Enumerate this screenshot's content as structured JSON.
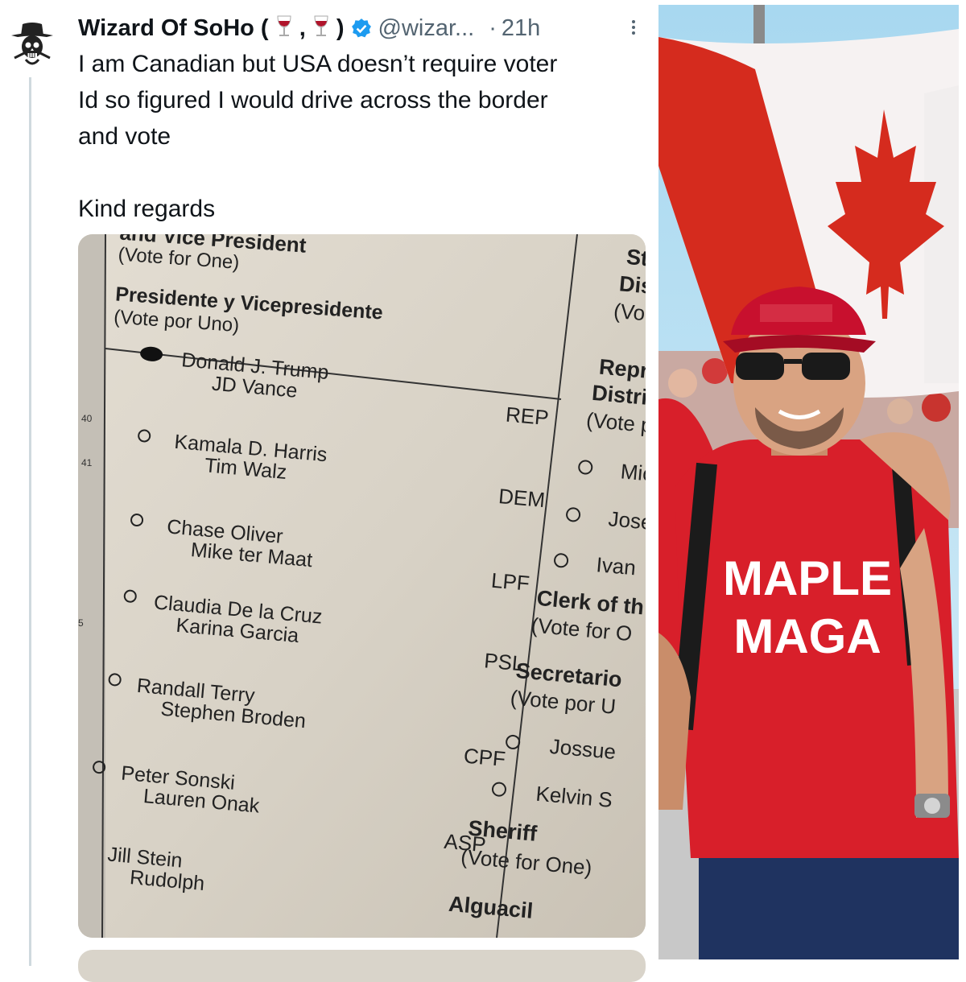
{
  "tweet": {
    "display_name": "Wizard Of SoHo (",
    "name_sep": ",",
    "name_close": ")",
    "handle": "@wizar...",
    "dot": "·",
    "time": "21h",
    "avatar_icon": "skull-cowboy-avatar-icon",
    "verified_color": "#1d9bf0",
    "text_lines": [
      "I am Canadian but USA doesn’t require voter",
      "Id so figured I would drive across the border",
      "and vote",
      "Kind regards"
    ]
  },
  "ballot": {
    "header_top": "and Vice President",
    "vote_for_one": "(Vote for One)",
    "header_es": "Presidente y Vicepresidente",
    "vote_por_uno": "(Vote por Uno)",
    "row_numbers": [
      "40",
      "41",
      "5"
    ],
    "candidates": [
      {
        "p": "Donald J. Trump",
        "vp": "JD Vance",
        "party": "REP",
        "filled": true
      },
      {
        "p": "Kamala D. Harris",
        "vp": "Tim Walz",
        "party": "DEM",
        "filled": false
      },
      {
        "p": "Chase Oliver",
        "vp": "Mike ter Maat",
        "party": "LPF",
        "filled": false
      },
      {
        "p": "Claudia De la Cruz",
        "vp": "Karina Garcia",
        "party": "PSL",
        "filled": false
      },
      {
        "p": "Randall Terry",
        "vp": "Stephen Broden",
        "party": "CPF",
        "filled": false
      },
      {
        "p": "Peter Sonski",
        "vp": "Lauren Onak",
        "party": "ASP",
        "filled": false
      },
      {
        "p": "Jill Stein",
        "vp": "Rudolph",
        "party": "",
        "filled": false
      }
    ],
    "right_column": {
      "state": "State",
      "distri": "Distri",
      "vote_t": "(Vote f",
      "repres": "Repres",
      "distrito": "Distrito",
      "vote_po": "(Vote po",
      "opt1": "Mic",
      "opt2": "Jose",
      "opt3": "Ivan",
      "clerk": "Clerk of th",
      "clerk_vote": "(Vote for O",
      "secretario": "Secretario",
      "sec_vote": "(Vote por U",
      "opt4": "Jossue",
      "opt5": "Kelvin S",
      "sheriff": "Sheriff",
      "sheriff_vote": "(Vote for One)",
      "alguacil": "Alguacil"
    }
  },
  "photo": {
    "hat_text": "",
    "shirt_line1": "MAPLE",
    "shirt_line2": "MAGA",
    "flag_red": "#d52b1e",
    "shirt_red": "#d81f2a"
  }
}
